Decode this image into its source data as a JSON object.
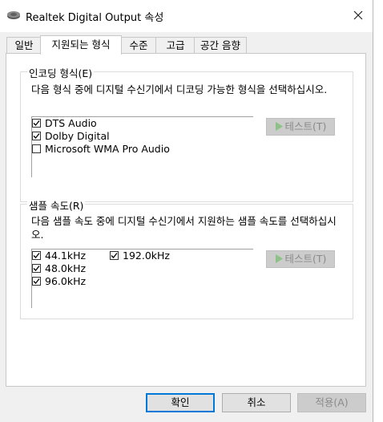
{
  "window": {
    "title": "Realtek Digital Output 속성"
  },
  "tabs": [
    {
      "label": "일반",
      "active": false
    },
    {
      "label": "지원되는 형식",
      "active": true
    },
    {
      "label": "수준",
      "active": false
    },
    {
      "label": "고급",
      "active": false
    },
    {
      "label": "공간 음향",
      "active": false
    }
  ],
  "encoding": {
    "title": "인코딩 형식(E)",
    "description": "다음 형식 중에 디지털 수신기에서 디코딩 가능한 형식을 선택하십시오.",
    "items": [
      {
        "label": "DTS Audio",
        "checked": true
      },
      {
        "label": "Dolby Digital",
        "checked": true
      },
      {
        "label": "Microsoft WMA Pro Audio",
        "checked": false
      }
    ],
    "test_label": "테스트(T)"
  },
  "sample_rate": {
    "title": "샘플 속도(R)",
    "description": "다음 샘플 속도 중에 디지털 수신기에서 지원하는 샘플 속도를 선택하십시오.",
    "items": [
      {
        "label": "44.1kHz",
        "checked": true
      },
      {
        "label": "48.0kHz",
        "checked": true
      },
      {
        "label": "96.0kHz",
        "checked": true
      },
      {
        "label": "192.0kHz",
        "checked": true
      }
    ],
    "test_label": "테스트(T)"
  },
  "buttons": {
    "ok": "확인",
    "cancel": "취소",
    "apply": "적용(A)"
  },
  "colors": {
    "accent": "#0078d7",
    "disabled_text": "#8a8a8a",
    "disabled_bg": "#cccccc",
    "play_icon": "#8fc08a"
  }
}
